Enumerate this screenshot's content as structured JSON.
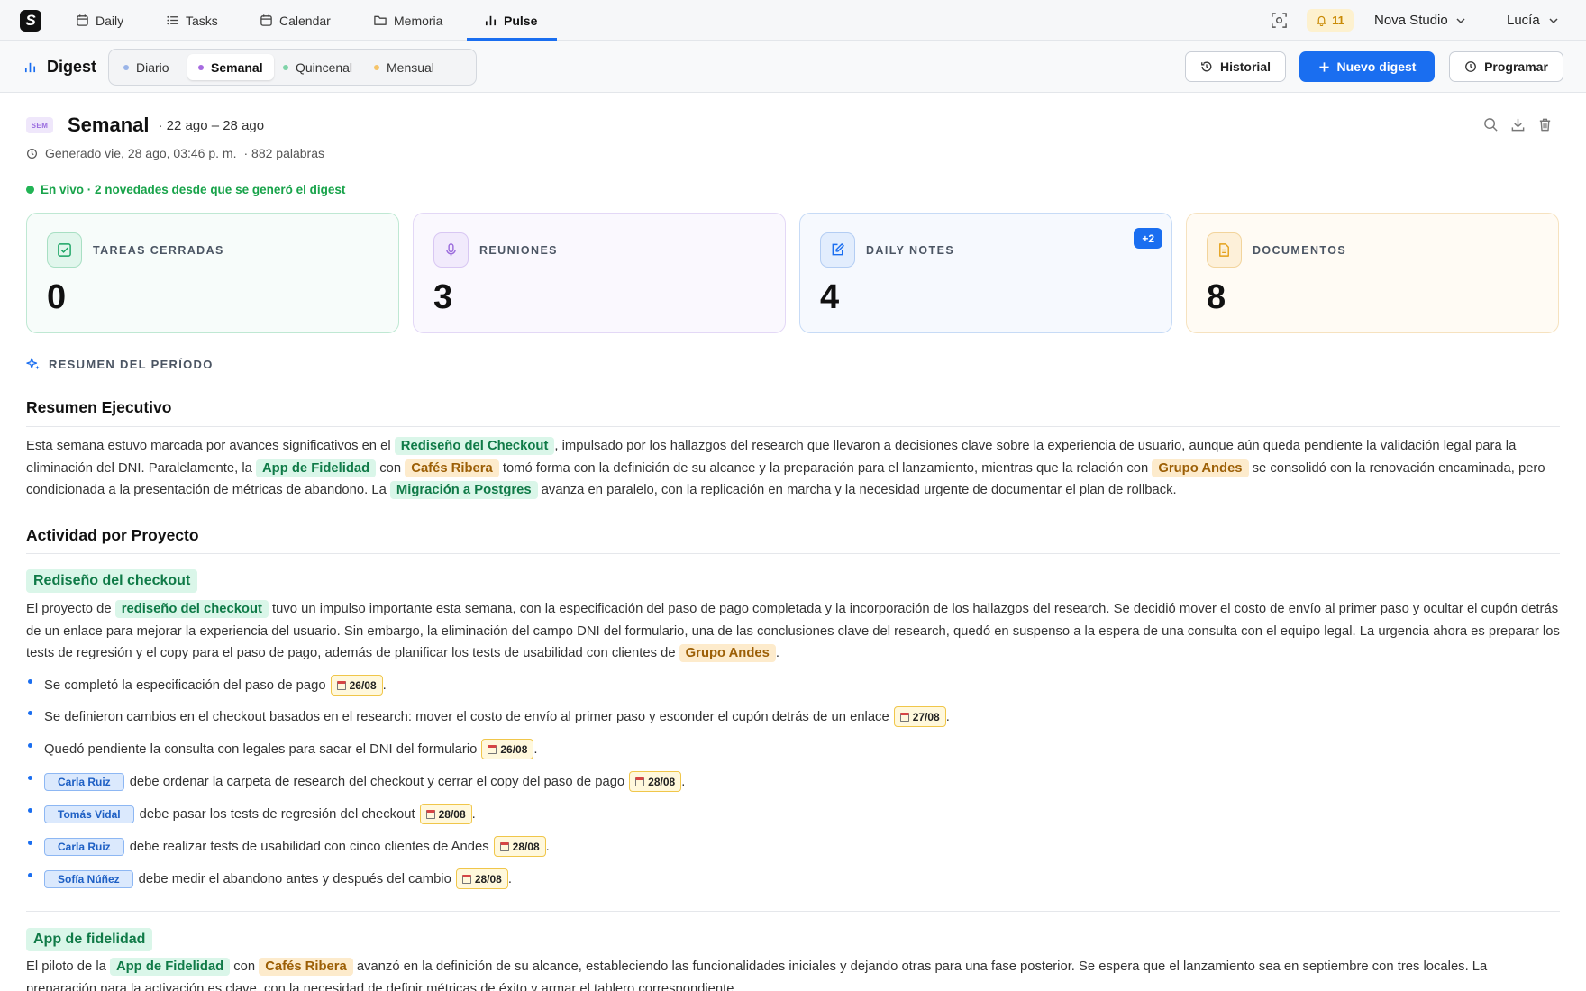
{
  "nav": {
    "tabs": [
      {
        "label": "Daily",
        "icon": "calendar-day-icon"
      },
      {
        "label": "Tasks",
        "icon": "list-icon"
      },
      {
        "label": "Calendar",
        "icon": "calendar-icon"
      },
      {
        "label": "Memoria",
        "icon": "folder-icon"
      },
      {
        "label": "Pulse",
        "icon": "bar-chart-icon"
      }
    ],
    "active_tab": "Pulse",
    "notifications": "11",
    "workspace": "Nova Studio",
    "user": "Lucía"
  },
  "subheader": {
    "title": "Digest",
    "periods": [
      {
        "label": "Diario",
        "color": "#9ab4e8"
      },
      {
        "label": "Semanal",
        "color": "#a66ae0"
      },
      {
        "label": "Quincenal",
        "color": "#7fd3a8"
      },
      {
        "label": "Mensual",
        "color": "#f5c46a"
      }
    ],
    "active_period": "Semanal",
    "history_label": "Historial",
    "new_label": "Nuevo digest",
    "schedule_label": "Programar"
  },
  "digest": {
    "badge": "SEM",
    "title": "Semanal",
    "range": "· 22 ago – 28 ago",
    "generated": "Generado vie, 28 ago, 03:46 p. m.",
    "words": "· 882 palabras",
    "live": "En vivo · 2 novedades desde que se generó el digest"
  },
  "stats": [
    {
      "label": "TAREAS CERRADAS",
      "value": "0",
      "icon": "check-square-icon",
      "accent": "#19a463"
    },
    {
      "label": "REUNIONES",
      "value": "3",
      "icon": "microphone-icon",
      "accent": "#9b6bdc"
    },
    {
      "label": "DAILY NOTES",
      "value": "4",
      "icon": "edit-note-icon",
      "accent": "#1a6ef0",
      "badge": "+2"
    },
    {
      "label": "DOCUMENTOS",
      "value": "8",
      "icon": "document-icon",
      "accent": "#e4a11b"
    }
  ],
  "summary": {
    "section_label": "RESUMEN DEL PERÍODO",
    "exec_heading": "Resumen Ejecutivo",
    "exec_parts": [
      {
        "t": "Esta semana estuvo marcada por avances significativos en el "
      },
      {
        "t": "Rediseño del Checkout",
        "tag": "g"
      },
      {
        "t": ", impulsado por los hallazgos del research que llevaron a decisiones clave sobre la experiencia de usuario, aunque aún queda pendiente la validación legal para la eliminación del DNI. Paralelamente, la "
      },
      {
        "t": "App de Fidelidad",
        "tag": "g"
      },
      {
        "t": " con "
      },
      {
        "t": "Cafés Ribera",
        "tag": "o"
      },
      {
        "t": " tomó forma con la definición de su alcance y la preparación para el lanzamiento, mientras que la relación con "
      },
      {
        "t": "Grupo Andes",
        "tag": "o"
      },
      {
        "t": " se consolidó con la renovación encaminada, pero condicionada a la presentación de métricas de abandono. La "
      },
      {
        "t": "Migración a Postgres",
        "tag": "g"
      },
      {
        "t": " avanza en paralelo, con la replicación en marcha y la necesidad urgente de documentar el plan de rollback."
      }
    ],
    "activity_heading": "Actividad por Proyecto"
  },
  "projects": [
    {
      "title": "Rediseño del checkout",
      "intro": [
        {
          "t": "El proyecto de "
        },
        {
          "t": "rediseño del checkout",
          "tag": "g"
        },
        {
          "t": " tuvo un impulso importante esta semana, con la especificación del paso de pago completada y la incorporación de los hallazgos del research. Se decidió mover el costo de envío al primer paso y ocultar el cupón detrás de un enlace para mejorar la experiencia del usuario. Sin embargo, la eliminación del campo DNI del formulario, una de las conclusiones clave del research, quedó en suspenso a la espera de una consulta con el equipo legal. La urgencia ahora es preparar los tests de regresión y el copy para el paso de pago, además de planificar los tests de usabilidad con clientes de "
        },
        {
          "t": "Grupo Andes",
          "tag": "o"
        },
        {
          "t": "."
        }
      ],
      "bullets": [
        {
          "person": "",
          "text": "Se completó la especificación del paso de pago",
          "date": "26/08"
        },
        {
          "person": "",
          "text": "Se definieron cambios en el checkout basados en el research: mover el costo de envío al primer paso y esconder el cupón detrás de un enlace",
          "date": "27/08"
        },
        {
          "person": "",
          "text": "Quedó pendiente la consulta con legales para sacar el DNI del formulario",
          "date": "26/08"
        },
        {
          "person": "Carla Ruiz",
          "text": "debe ordenar la carpeta de research del checkout y cerrar el copy del paso de pago",
          "date": "28/08"
        },
        {
          "person": "Tomás Vidal",
          "text": "debe pasar los tests de regresión del checkout",
          "date": "28/08"
        },
        {
          "person": "Carla Ruiz",
          "text": "debe realizar tests de usabilidad con cinco clientes de Andes",
          "date": "28/08"
        },
        {
          "person": "Sofía Núñez",
          "text": "debe medir el abandono antes y después del cambio",
          "date": "28/08"
        }
      ]
    },
    {
      "title": "App de fidelidad",
      "intro": [
        {
          "t": "El piloto de la "
        },
        {
          "t": "App de Fidelidad",
          "tag": "g"
        },
        {
          "t": " con "
        },
        {
          "t": "Cafés Ribera",
          "tag": "o"
        },
        {
          "t": " avanzó en la definición de su alcance, estableciendo las funcionalidades iniciales y dejando otras para una fase posterior. Se espera que el lanzamiento sea en septiembre con tres locales. La preparación para la activación es clave, con la necesidad de definir métricas de éxito y armar el tablero correspondiente."
        }
      ]
    }
  ]
}
